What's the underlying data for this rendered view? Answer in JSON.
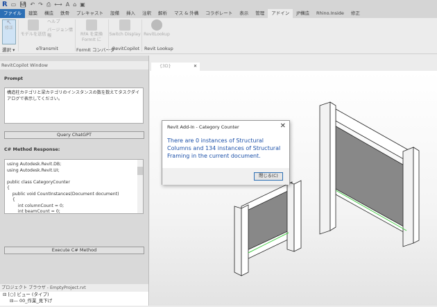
{
  "qat": {
    "logo": "R"
  },
  "tabs": [
    "ファイル",
    "建築",
    "構造",
    "鉄骨",
    "プレキャスト",
    "設備",
    "挿入",
    "注釈",
    "解析",
    "マス & 外構",
    "コラボレート",
    "表示",
    "管理",
    "アドイン",
    "JP構造",
    "Rhino.Inside",
    "修正"
  ],
  "active_tab": "アドイン",
  "ribbon": {
    "modify": "修正",
    "select": "選択 ▾",
    "send_model": "モデルを送信",
    "help": "ヘルプ",
    "version_info": "バージョン情報",
    "etransmit": "eTransmit",
    "rfa_convert": "RFA を変換",
    "formit_to": "FormIt に",
    "formit_converter": "FormIt コンバータ",
    "switch_display": "Switch Display",
    "revitcopilot": "RevitCopilot",
    "revitlookup_btn": "RevitLookup",
    "revitlookup": "Revit Lookup"
  },
  "copilot": {
    "title": "RevitCopilot Window",
    "prompt_label": "Prompt",
    "prompt_text": "構造柱カテゴリと梁カテゴリのインスタンスの数を数えてタスクダイアログで表示してください。",
    "query_button": "Query ChatGPT",
    "response_label": "C# Method Response:",
    "code": "using Autodesk.Revit.DB;\nusing Autodesk.Revit.UI;\n\npublic class CategoryCounter\n{\n    public void CountInstances(Document document)\n    {\n        int columnCount = 0;\n        int beamCount = 0;",
    "execute_button": "Execute C# Method"
  },
  "project_browser": {
    "title": "プロジェクト ブラウザ - EmptyProject.rvt",
    "items": [
      "ビュー (タイプ)",
      "00_作業_見下げ"
    ]
  },
  "view": {
    "tab": "{3D}"
  },
  "dialog": {
    "title": "Revit Add-In - Category Counter",
    "message": "There are 0 instances of Structural Columns and 134 instances of Structural Framing in the current document.",
    "close_button": "閉じる(C)"
  }
}
